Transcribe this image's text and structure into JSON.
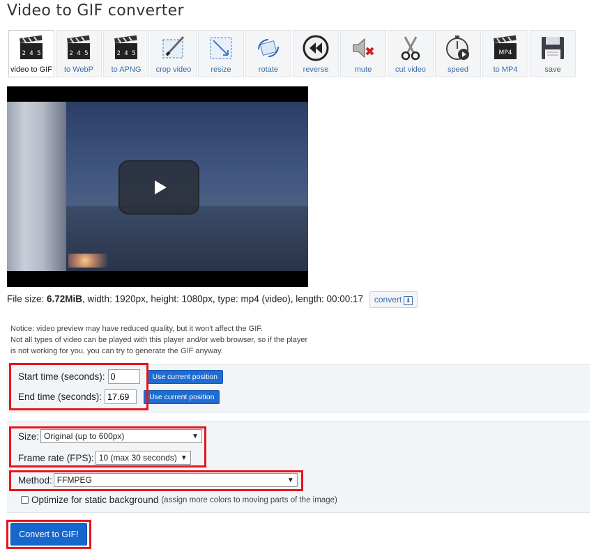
{
  "page": {
    "title": "Video to GIF converter"
  },
  "toolbar": {
    "items": [
      {
        "label": "video to GIF",
        "icon": "clapperboard-icon",
        "active": true
      },
      {
        "label": "to WebP",
        "icon": "clapperboard-icon",
        "active": false
      },
      {
        "label": "to APNG",
        "icon": "clapperboard-icon",
        "active": false
      },
      {
        "label": "crop video",
        "icon": "crop-icon",
        "active": false
      },
      {
        "label": "resize",
        "icon": "resize-icon",
        "active": false
      },
      {
        "label": "rotate",
        "icon": "rotate-icon",
        "active": false
      },
      {
        "label": "reverse",
        "icon": "reverse-icon",
        "active": false
      },
      {
        "label": "mute",
        "icon": "mute-icon",
        "active": false
      },
      {
        "label": "cut video",
        "icon": "scissors-icon",
        "active": false
      },
      {
        "label": "speed",
        "icon": "stopwatch-icon",
        "active": false
      },
      {
        "label": "to MP4",
        "icon": "clapperboard-mp4-icon",
        "active": false
      },
      {
        "label": "save",
        "icon": "floppy-disk-icon",
        "active": false
      }
    ],
    "clapper_text": "2 4 5",
    "mp4_text": "MP4"
  },
  "fileinfo": {
    "prefix": "File size: ",
    "size": "6.72MiB",
    "details": ", width: 1920px, height: 1080px, type: mp4 (video), length: 00:00:17",
    "convert_label": "convert"
  },
  "notice": {
    "line1": "Notice: video preview may have reduced quality, but it won't affect the GIF.",
    "line2": "Not all types of video can be played with this player and/or web browser, so if the player",
    "line3": "is not working for you, you can try to generate the GIF anyway."
  },
  "form": {
    "start_label": "Start time (seconds):",
    "start_value": "0",
    "end_label": "End time (seconds):",
    "end_value": "17.69",
    "use_position_label": "Use current position",
    "size_label": "Size:",
    "size_value": "Original (up to 600px)",
    "fps_label": "Frame rate (FPS):",
    "fps_value": "10 (max 30 seconds)",
    "method_label": "Method:",
    "method_value": "FFMPEG",
    "optimize_label": "Optimize for static background",
    "optimize_note": "(assign more colors to moving parts of the image)",
    "submit_label": "Convert to GIF!"
  },
  "colors": {
    "highlight": "#e8141c",
    "button_blue": "#1566cd",
    "link_blue": "#3a6ea5"
  }
}
